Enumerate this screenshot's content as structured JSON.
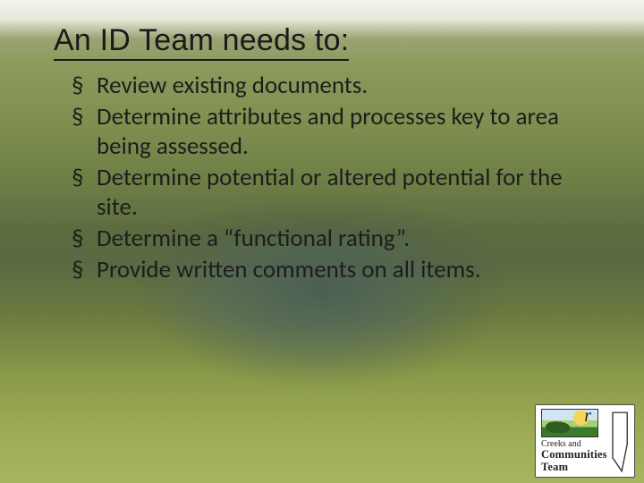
{
  "title": "An ID Team needs to:",
  "bullets": [
    "Review existing documents.",
    "Determine attributes and processes key to area being assessed.",
    "Determine potential or altered potential for the site.",
    "Determine a “functional rating”.",
    "Provide written comments on all items."
  ],
  "logo": {
    "line1": "Creeks and",
    "line2": "Communities",
    "line3": "Team",
    "mark": "r"
  }
}
